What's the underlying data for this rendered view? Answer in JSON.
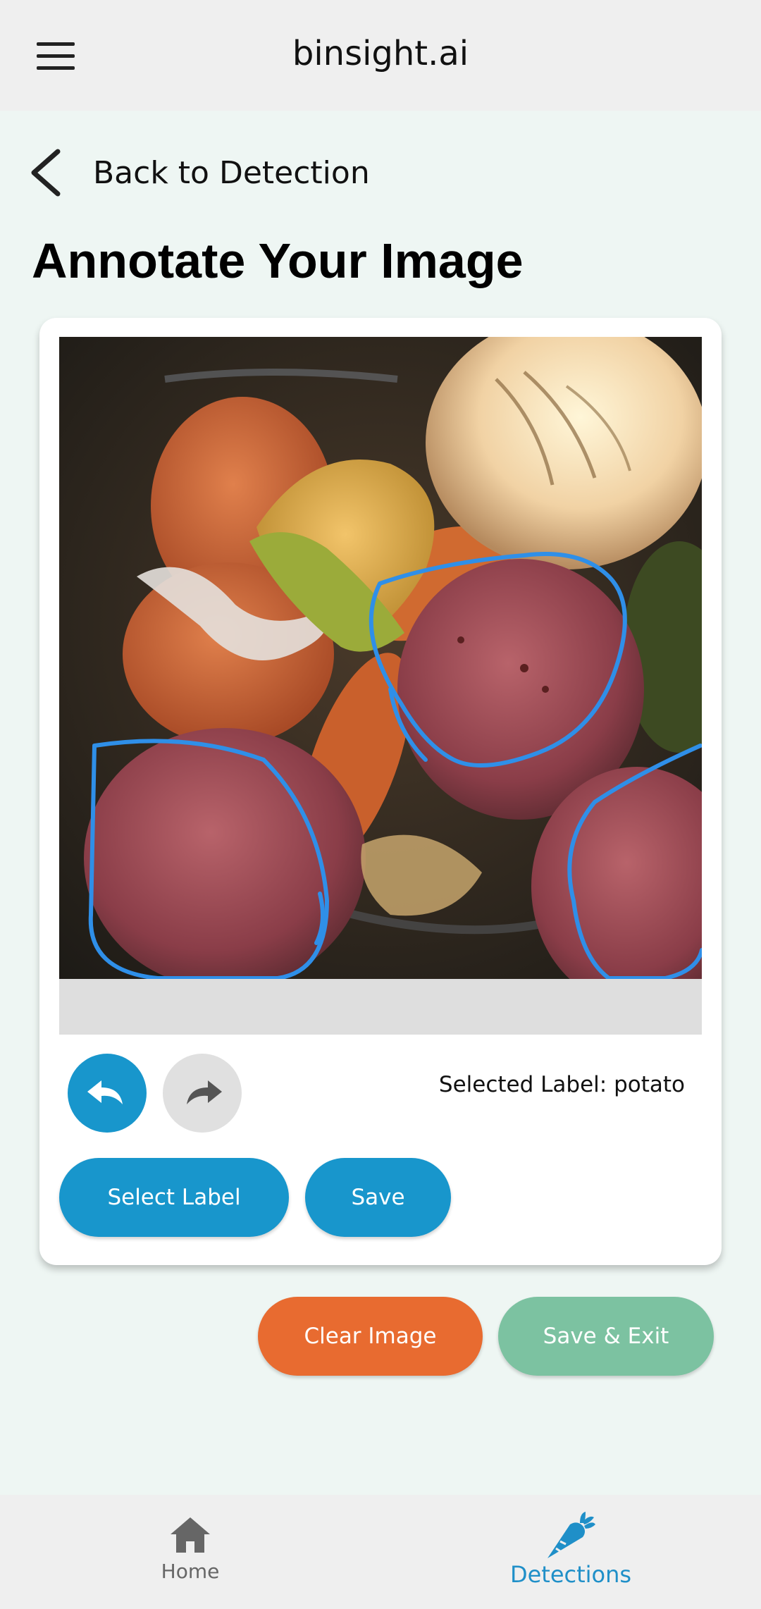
{
  "app_bar": {
    "title": "binsight.ai",
    "menu_icon": "hamburger-menu-icon"
  },
  "back_link": {
    "label": "Back to Detection",
    "icon": "chevron-left-icon"
  },
  "page": {
    "title": "Annotate Your Image"
  },
  "annotator": {
    "image_alt": "food scraps bin photo",
    "annotation_color": "#2f8fe8",
    "undo_icon": "undo-icon",
    "redo_icon": "redo-icon",
    "selected_label_text": "Selected Label: potato",
    "select_label_button": "Select Label",
    "save_button": "Save"
  },
  "actions": {
    "clear_image": "Clear Image",
    "save_exit": "Save & Exit"
  },
  "bottom_nav": {
    "items": [
      {
        "label": "Home",
        "icon": "home-icon",
        "active": false
      },
      {
        "label": "Detections",
        "icon": "carrot-icon",
        "active": true
      }
    ]
  },
  "colors": {
    "primary": "#1896cc",
    "clear": "#e86b30",
    "save_exit": "#7cc2a1",
    "background": "#eef6f3"
  }
}
